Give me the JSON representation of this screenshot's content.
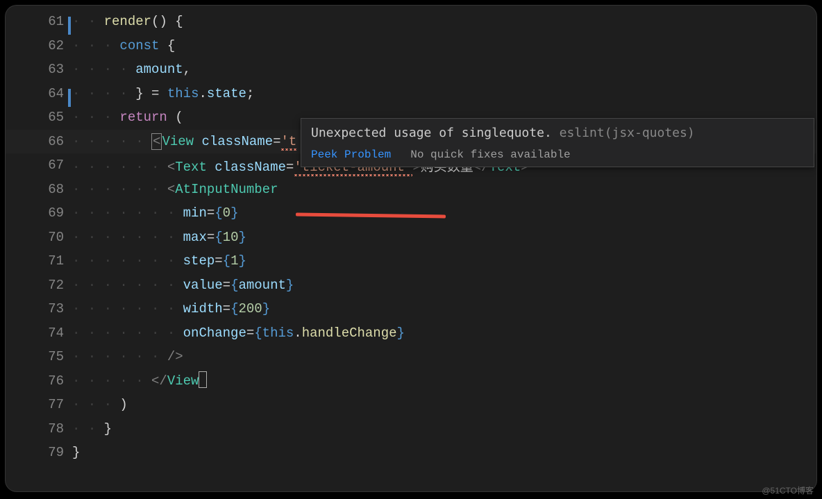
{
  "tooltip": {
    "message": "Unexpected usage of singlequote.",
    "rule_source": "eslint(jsx-quotes)",
    "peek_label": "Peek Problem",
    "no_fix_label": "No quick fixes available"
  },
  "gutter": {
    "l61": "61",
    "l62": "62",
    "l63": "63",
    "l64": "64",
    "l65": "65",
    "l66": "66",
    "l67": "67",
    "l68": "68",
    "l69": "69",
    "l70": "70",
    "l71": "71",
    "l72": "72",
    "l73": "73",
    "l74": "74",
    "l75": "75",
    "l76": "76",
    "l77": "77",
    "l78": "78",
    "l79": "79"
  },
  "code": {
    "l61": {
      "render": "render",
      "paren_open": "()",
      "brace": " {"
    },
    "l62": {
      "const": "const",
      "brace": " {"
    },
    "l63": {
      "amount": "amount",
      "comma": ","
    },
    "l64": {
      "brace_close": "}",
      "eq": " = ",
      "this": "this",
      "dot": ".",
      "state": "state",
      "semi": ";"
    },
    "l65": {
      "return": "return",
      "paren": " ("
    },
    "l66": {
      "lt": "<",
      "View": "View",
      "sp": " ",
      "className": "className",
      "eq": "=",
      "str": "'t"
    },
    "l67": {
      "lt": "<",
      "Text": "Text",
      "sp": " ",
      "className": "className",
      "eq": "=",
      "str": "'ticket-amount'",
      "gt": ">",
      "txt": "购买数量",
      "lt2": "</",
      "Text2": "Text",
      "gt2": ">"
    },
    "l68": {
      "lt": "<",
      "AtInputNumber": "AtInputNumber"
    },
    "l69": {
      "min": "min",
      "eq": "=",
      "bo": "{",
      "val": "0",
      "bc": "}"
    },
    "l70": {
      "max": "max",
      "eq": "=",
      "bo": "{",
      "val": "10",
      "bc": "}"
    },
    "l71": {
      "step": "step",
      "eq": "=",
      "bo": "{",
      "val": "1",
      "bc": "}"
    },
    "l72": {
      "value": "value",
      "eq": "=",
      "bo": "{",
      "val": "amount",
      "bc": "}"
    },
    "l73": {
      "width": "width",
      "eq": "=",
      "bo": "{",
      "val": "200",
      "bc": "}"
    },
    "l74": {
      "onChange": "onChange",
      "eq": "=",
      "bo": "{",
      "this": "this",
      "dot": ".",
      "fn": "handleChange",
      "bc": "}"
    },
    "l75": {
      "close": "/>"
    },
    "l76": {
      "lt": "</",
      "View": "View",
      "gt": ">"
    },
    "l77": {
      "paren": ")"
    },
    "l78": {
      "brace": "}"
    },
    "l79": {
      "brace": "}"
    }
  },
  "watermark": "@51CTO博客"
}
